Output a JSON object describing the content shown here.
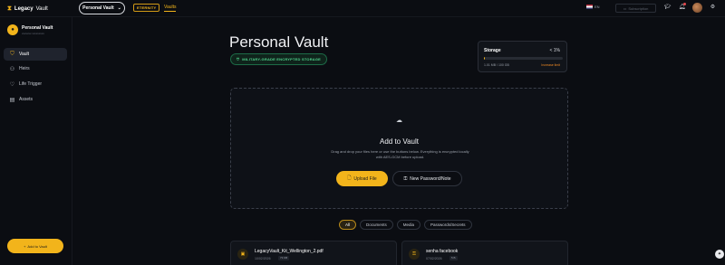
{
  "topbar": {
    "logo_text_bold": "Legacy",
    "logo_text_light": "Vault",
    "vault_selector": "Personal Vault",
    "eternity_badge": "ETERNITY",
    "nav_vaults": "Vaults",
    "language": "EN",
    "subscription": "Subscription"
  },
  "sidebar": {
    "user_name": "Personal Vault",
    "user_sub": "xxxxxxx xxxxxxxxx",
    "items": [
      {
        "label": "Vault",
        "icon": "shield-icon"
      },
      {
        "label": "Heirs",
        "icon": "users-icon"
      },
      {
        "label": "Life Trigger",
        "icon": "heartbeat-icon"
      },
      {
        "label": "Assets",
        "icon": "assets-icon"
      }
    ],
    "add_vault": "Add to Vault"
  },
  "main": {
    "title": "Personal Vault",
    "encrypted_badge": "MILITARY-GRADE ENCRYPTED STORAGE",
    "storage": {
      "title": "Storage",
      "percent": "< 1%",
      "percent_value": 0.5,
      "used": "1.01 MB / 100 GB",
      "increase": "Increase limit"
    },
    "dropzone": {
      "title": "Add to Vault",
      "description": "Drag and drop your files here or use the buttons below. Everything is encrypted locally with AES-GCM before upload.",
      "upload_button": "Upload File",
      "password_button": "New Password/Note"
    },
    "filters": [
      "All",
      "Documents",
      "Media",
      "Passwords/Secrets"
    ],
    "active_filter": "All",
    "cards": [
      {
        "name": "LegacyVault_Kit_Wellington_2.pdf",
        "date": "10/02/2026",
        "tag": "73 KB"
      },
      {
        "name": "senha facebook",
        "date": "07/02/2026",
        "tag": "5 B"
      }
    ]
  },
  "colors": {
    "accent": "#f2b41b",
    "background": "#0b0d12",
    "success": "#4fd18b",
    "warning": "#f08a24"
  }
}
